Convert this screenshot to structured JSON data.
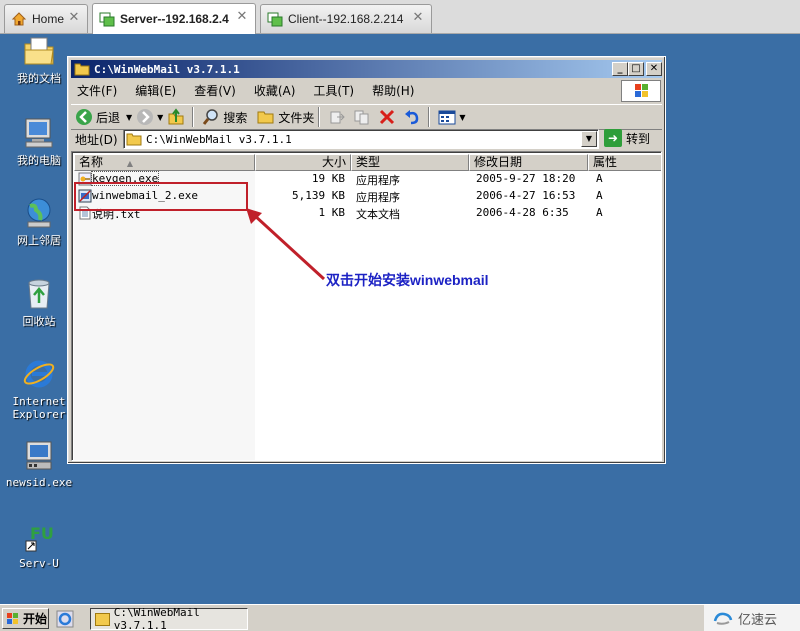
{
  "tabs": [
    {
      "label": "Home",
      "icon": "home-icon",
      "active": false
    },
    {
      "label": "Server--192.168.2.4",
      "icon": "vm-icon",
      "active": true
    },
    {
      "label": "Client--192.168.2.214",
      "icon": "vm-icon",
      "active": false
    }
  ],
  "desktop_icons": [
    {
      "label": "我的文档",
      "icon": "my-documents-icon"
    },
    {
      "label": "我的电脑",
      "icon": "my-computer-icon"
    },
    {
      "label": "网上邻居",
      "icon": "network-places-icon"
    },
    {
      "label": "回收站",
      "icon": "recycle-bin-icon"
    },
    {
      "label": "Internet\nExplorer",
      "icon": "internet-explorer-icon"
    },
    {
      "label": "newsid.exe",
      "icon": "newsid-icon"
    },
    {
      "label": "Serv-U",
      "icon": "serv-u-icon"
    }
  ],
  "window": {
    "title": "C:\\WinWebMail v3.7.1.1",
    "menu": [
      "文件(F)",
      "编辑(E)",
      "查看(V)",
      "收藏(A)",
      "工具(T)",
      "帮助(H)"
    ],
    "toolbar": {
      "back": "后退",
      "search": "搜索",
      "folders": "文件夹"
    },
    "address": {
      "label": "地址(D)",
      "value": "C:\\WinWebMail v3.7.1.1",
      "go": "转到"
    },
    "columns": [
      "名称",
      "大小",
      "类型",
      "修改日期",
      "属性"
    ],
    "files": [
      {
        "name": "keygen.exe",
        "size": "19 KB",
        "type": "应用程序",
        "modified": "2005-9-27 18:20",
        "attr": "A",
        "icon": "keygen-icon"
      },
      {
        "name": "winwebmail_2.exe",
        "size": "5,139 KB",
        "type": "应用程序",
        "modified": "2006-4-27 16:53",
        "attr": "A",
        "icon": "installer-icon"
      },
      {
        "name": "说明.txt",
        "size": "1 KB",
        "type": "文本文档",
        "modified": "2006-4-28 6:35",
        "attr": "A",
        "icon": "text-file-icon"
      }
    ]
  },
  "annotation": {
    "text": "双击开始安装winwebmail",
    "color": "#1c22c4",
    "highlight_color": "#c0202a"
  },
  "taskbar": {
    "start": "开始",
    "task": "C:\\WinWebMail v3.7.1.1"
  },
  "watermark": "亿速云"
}
